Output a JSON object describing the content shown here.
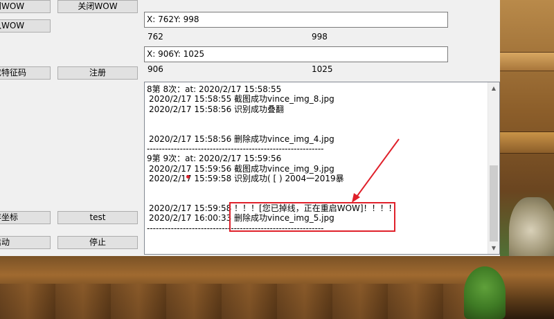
{
  "buttons": {
    "b1": "到WOW",
    "b2": "关闭WOW",
    "b3": "入WOW",
    "b4": "成特征码",
    "b5": "注册",
    "b6": "存坐标",
    "b7": "test",
    "b8": "启动",
    "b9": "停止"
  },
  "coords": {
    "box1": "X: 762Y: 998",
    "x1": "762",
    "y1": "998",
    "box2": "X: 906Y: 1025",
    "x2": "906",
    "y2": "1025"
  },
  "log": [
    {
      "text": "8第 8次：at: 2020/2/17 15:58:55",
      "indent": false
    },
    {
      "text": "2020/2/17 15:58:55  截图成功vince_img_8.jpg",
      "indent": true
    },
    {
      "text": "2020/2/17 15:58:56  识别成功叠翻",
      "indent": true
    },
    {
      "text": "",
      "indent": false
    },
    {
      "text": "",
      "indent": false
    },
    {
      "text": "2020/2/17 15:58:56  删除成功vince_img_4.jpg",
      "indent": true
    },
    {
      "text": "-----------------------------------------------------------",
      "indent": false
    },
    {
      "text": "9第 9次：at: 2020/2/17 15:59:56",
      "indent": false
    },
    {
      "text": "2020/2/17 15:59:56  截图成功vince_img_9.jpg",
      "indent": true
    },
    {
      "text": "2020/2/17 15:59:58  识别成功( [ ) 2004一2019暴",
      "indent": true
    },
    {
      "text": "",
      "indent": false
    },
    {
      "text": "",
      "indent": false
    },
    {
      "text": "2020/2/17 15:59:58  ！！！[您已掉线，正在重启WOW]！！！！",
      "indent": true
    },
    {
      "text": "2020/2/17 16:00:33  删除成功vince_img_5.jpg",
      "indent": true
    },
    {
      "text": "-----------------------------------------------------------",
      "indent": false
    }
  ],
  "colors": {
    "annotation": "#e0202a"
  }
}
